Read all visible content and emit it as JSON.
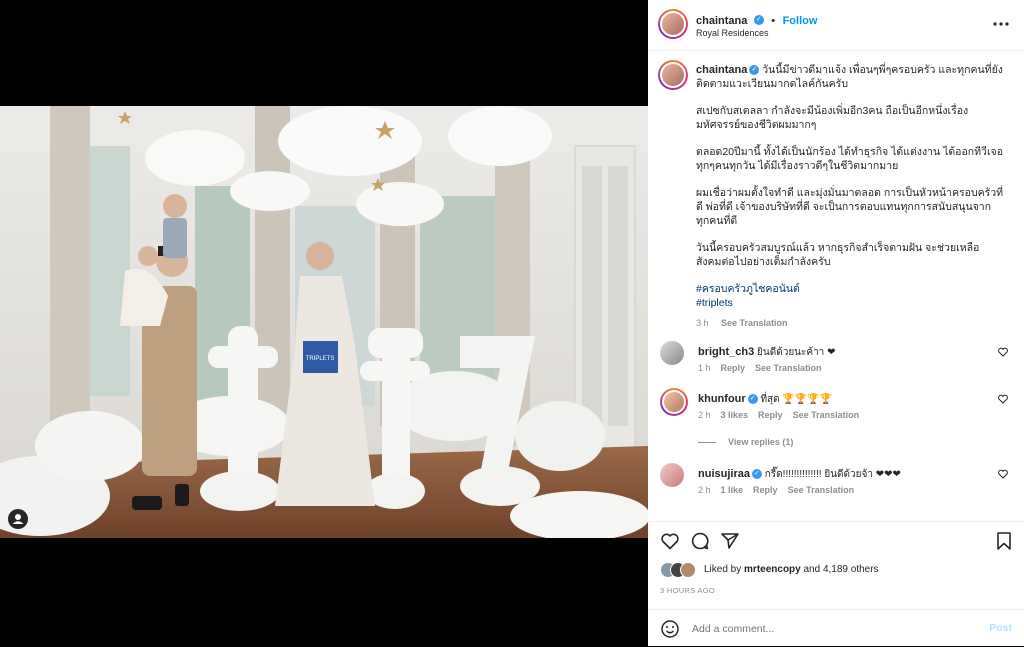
{
  "post": {
    "username": "chaintana",
    "follow_label": "Follow",
    "location": "Royal Residences",
    "more_icon": "more-dots-icon"
  },
  "image": {
    "sign_text": "TRIPLETS",
    "number_text": "7"
  },
  "caption": {
    "username": "chaintana",
    "paragraphs": [
      "วันนี้มีข่าวดีมาแจ้ง เพื่อนๆพี่ๆครอบครัว และทุกคนที่ยังติดตามแวะเวียนมากดไลค์กันครับ",
      "สเปซกับสเตลลา กำลังจะมีน้องเพิ่มอีก3คน ถือเป็นอีกหนึ่งเรื่องมหัศจรรย์ของชีวิตผมมากๆ",
      "ตลอด20ปีมานี้ ทั้งได้เป็นนักร้อง ได้ทำธุรกิจ ได้แต่งงาน ได้ออกทีวีเจอทุกๆคนทุกวัน ได้มีเรื่องราวดีๆในชีวิตมากมาย",
      "ผมเชื่อว่าผมตั้งใจทำดี และมุ่งมั่นมาตลอด การเป็นหัวหน้าครอบครัวที่ดี พ่อที่ดี เจ้าของบริษัทที่ดี จะเป็นการตอบแทนทุกการสนับสนุนจากทุกคนที่ดี",
      "วันนี้ครอบครัวสมบูรณ์แล้ว หากธุรกิจสำเร็จตามฝัน จะช่วยเหลือสังคมต่อไปอย่างเต็มกำลังครับ"
    ],
    "hashtags": [
      "#ครอบครัวภูไชคอนันต์",
      "#triplets"
    ],
    "time": "3 h",
    "translation_label": "See Translation"
  },
  "comments": [
    {
      "username": "bright_ch3",
      "verified": false,
      "text": "ยินดีด้วยนะค้าา ❤",
      "time": "1 h",
      "likes": "",
      "reply_label": "Reply",
      "translation_label": "See Translation"
    },
    {
      "username": "khunfour",
      "verified": true,
      "text": "ที่สุด 🏆🏆🏆🏆",
      "time": "2 h",
      "likes": "3 likes",
      "reply_label": "Reply",
      "translation_label": "See Translation",
      "view_replies": "View replies (1)"
    },
    {
      "username": "nuisujiraa",
      "verified": true,
      "text": "กรี๊ด!!!!!!!!!!!!!! ยินดีด้วยจ้า ❤❤❤",
      "time": "2 h",
      "likes": "1 like",
      "reply_label": "Reply",
      "translation_label": "See Translation"
    }
  ],
  "actions": {
    "liked_by_prefix": "Liked by",
    "liked_by_user": "mrteencopy",
    "liked_by_suffix": "and 4,189 others",
    "timestamp": "3 HOURS AGO"
  },
  "add_comment": {
    "placeholder": "Add a comment...",
    "post_label": "Post"
  },
  "colors": {
    "accent": "#0095f6",
    "link": "#00376b",
    "heart": "#ed4956"
  }
}
